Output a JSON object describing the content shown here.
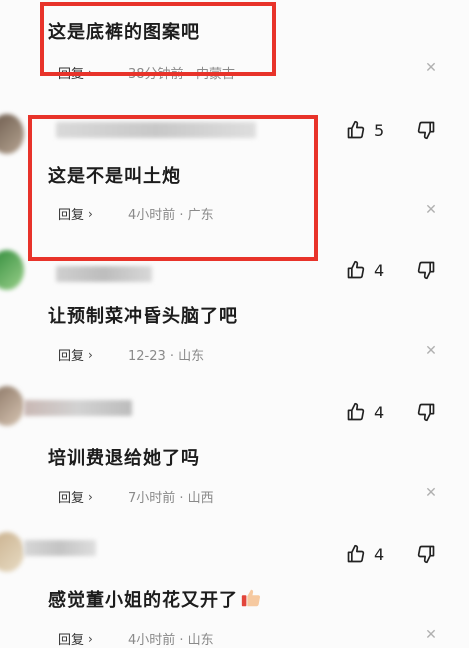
{
  "comments": [
    {
      "text": "这是底裤的图案吧",
      "reply_label": "回复",
      "meta": "38分钟前 · 内蒙古",
      "likes": ""
    },
    {
      "text": "这是不是叫土炮",
      "reply_label": "回复",
      "meta": "4小时前 · 广东",
      "likes": "5"
    },
    {
      "text": "让预制菜冲昏头脑了吧",
      "reply_label": "回复",
      "meta": "12-23 · 山东",
      "likes": "4"
    },
    {
      "text": "培训费退给她了吗",
      "reply_label": "回复",
      "meta": "7小时前 · 山西",
      "likes": "4"
    },
    {
      "text": "感觉董小姐的花又开了",
      "reply_label": "回复",
      "meta": "4小时前 · 山东",
      "likes": "4"
    }
  ],
  "icons": {
    "like": "thumbs-up-icon",
    "dislike": "thumbs-down-icon",
    "close": "close-icon",
    "reply_chevron": "chevron-right-icon"
  },
  "colors": {
    "highlight_border": "#e8332a",
    "meta_text": "#8a8a8a",
    "background": "#fbfbfb"
  }
}
